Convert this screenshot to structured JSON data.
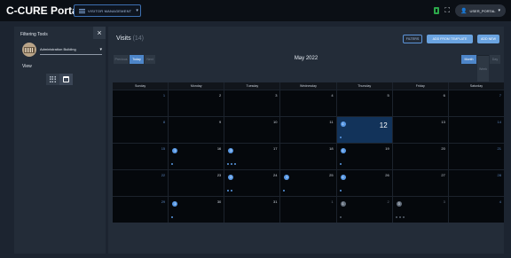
{
  "app": {
    "title": "C-CURE Portal"
  },
  "menu": {
    "label": "VISITOR MANAGEMENT"
  },
  "user": {
    "label": "USER_PORTAL"
  },
  "filter_panel": {
    "title": "Filtering Tools",
    "close_symbol": "×",
    "building": "Administration Building",
    "view_label": "View"
  },
  "main": {
    "title": "Visits",
    "count": "(14)",
    "buttons": {
      "filters": "FILTERS",
      "template": "ADD FROM TEMPLATE",
      "add_new": "ADD NEW"
    },
    "nav": {
      "previous": "Previous",
      "today": "Today",
      "next": "Next"
    },
    "month_label": "May 2022",
    "modes": {
      "month": "Month",
      "week": "Week",
      "day": "Day"
    }
  },
  "calendar": {
    "weekdays": [
      "Sunday",
      "Monday",
      "Tuesday",
      "Wednesday",
      "Thursday",
      "Friday",
      "Saturday"
    ],
    "weeks": [
      [
        {
          "n": "1",
          "t": "weekend"
        },
        {
          "n": "2"
        },
        {
          "n": "3"
        },
        {
          "n": "4"
        },
        {
          "n": "5"
        },
        {
          "n": "6"
        },
        {
          "n": "7",
          "t": "weekend"
        }
      ],
      [
        {
          "n": "8",
          "t": "weekend"
        },
        {
          "n": "9"
        },
        {
          "n": "10"
        },
        {
          "n": "11"
        },
        {
          "n": "12",
          "sel": true,
          "badge": "1",
          "dots": 1
        },
        {
          "n": "13"
        },
        {
          "n": "14",
          "t": "weekend"
        }
      ],
      [
        {
          "n": "15",
          "t": "weekend"
        },
        {
          "n": "16",
          "badge": "1",
          "dots": 1
        },
        {
          "n": "17",
          "badge": "3",
          "dots": 3
        },
        {
          "n": "18"
        },
        {
          "n": "19",
          "badge": "1",
          "dots": 1
        },
        {
          "n": "20"
        },
        {
          "n": "21",
          "t": "weekend"
        }
      ],
      [
        {
          "n": "22",
          "t": "weekend"
        },
        {
          "n": "23"
        },
        {
          "n": "24",
          "badge": "2",
          "dots": 2
        },
        {
          "n": "25",
          "badge": "1",
          "dots": 1
        },
        {
          "n": "26",
          "badge": "1",
          "dots": 1
        },
        {
          "n": "27"
        },
        {
          "n": "28",
          "t": "weekend"
        }
      ],
      [
        {
          "n": "29",
          "t": "weekend"
        },
        {
          "n": "30",
          "badge": "1",
          "dots": 1
        },
        {
          "n": "31"
        },
        {
          "n": "1",
          "t": "other"
        },
        {
          "n": "2",
          "t": "other",
          "badge": "1",
          "dim": true,
          "dots": 1
        },
        {
          "n": "3",
          "t": "other",
          "badge": "3",
          "dim": true,
          "dots": 3
        },
        {
          "n": "4",
          "t": "other-weekend"
        }
      ]
    ]
  },
  "colors": {
    "accent": "#5a9ae6",
    "selected_day": "#12335a",
    "background": "#1c2430"
  }
}
